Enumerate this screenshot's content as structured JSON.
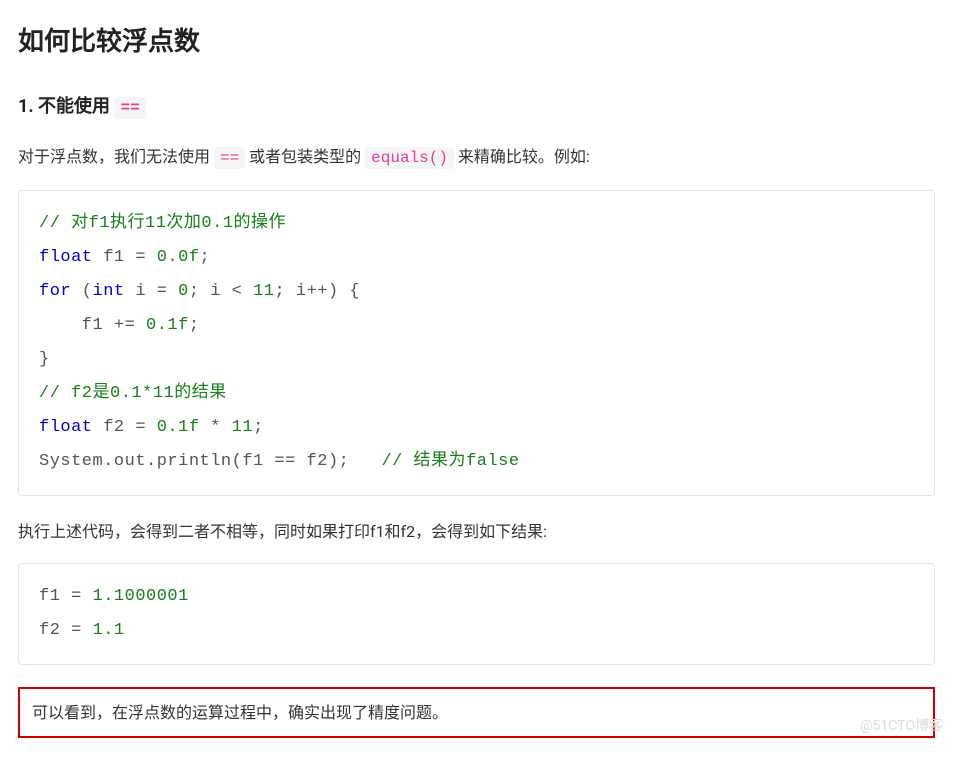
{
  "title": "如何比较浮点数",
  "section1": {
    "heading_prefix": "1. 不能使用 ",
    "heading_code": "=="
  },
  "para1": {
    "t1": "对于浮点数，我们无法使用 ",
    "code1": "==",
    "t2": " 或者包装类型的 ",
    "code2": "equals()",
    "t3": " 来精确比较。例如:"
  },
  "code1": {
    "l1_a": "// 对",
    "l1_b": "f1",
    "l1_c": "执行",
    "l1_d": "11",
    "l1_e": "次加",
    "l1_f": "0.1",
    "l1_g": "的操作",
    "l2_kw": "float",
    "l2_id": " f1 = ",
    "l2_num": "0.0f",
    "l2_end": ";",
    "l3_for": "for",
    "l3_a": " (",
    "l3_int": "int",
    "l3_b": " i = ",
    "l3_n0": "0",
    "l3_c": "; i < ",
    "l3_n11": "11",
    "l3_d": "; i++) {",
    "l4_a": "    f1 += ",
    "l4_n": "0.1f",
    "l4_b": ";",
    "l5": "}",
    "l6_a": "// f2",
    "l6_b": "是",
    "l6_c": "0.1*11",
    "l6_d": "的结果",
    "l7_kw": "float",
    "l7_a": " f2 = ",
    "l7_n1": "0.1f",
    "l7_b": " * ",
    "l7_n2": "11",
    "l7_c": ";",
    "l8_a": "System.out.println(f1 == f2);   ",
    "l8_c1": "// 结果为",
    "l8_c2": "false"
  },
  "para2": "执行上述代码，会得到二者不相等，同时如果打印f1和f2，会得到如下结果:",
  "code2": {
    "l1_a": "f1 = ",
    "l1_n": "1.1000001",
    "l2_a": "f2 = ",
    "l2_n": "1.1"
  },
  "para3": "可以看到，在浮点数的运算过程中，确实出现了精度问题。",
  "watermark": "@51CTO博客"
}
